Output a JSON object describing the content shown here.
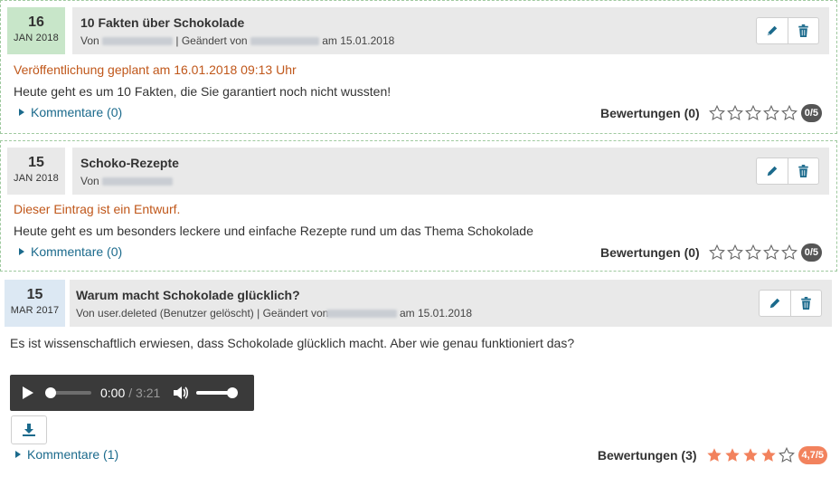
{
  "entries": [
    {
      "date_day": "16",
      "date_month": "JAN 2018",
      "title": "10 Fakten über Schokolade",
      "by_prefix": "Von",
      "changed_prefix": "| Geändert von",
      "changed_date": "am 15.01.2018",
      "notice": "Veröffentlichung geplant am 16.01.2018 09:13 Uhr",
      "text": "Heute geht es um 10 Fakten, die Sie garantiert noch nicht wussten!",
      "comments": "Kommentare (0)",
      "rating_label": "Bewertungen (0)",
      "rating_score": "0/5",
      "rating_value": 0
    },
    {
      "date_day": "15",
      "date_month": "JAN 2018",
      "title": "Schoko-Rezepte",
      "by_prefix": "Von",
      "notice": "Dieser Eintrag ist ein Entwurf.",
      "text": "Heute geht es um besonders leckere und einfache Rezepte rund um das Thema Schokolade",
      "comments": "Kommentare (0)",
      "rating_label": "Bewertungen (0)",
      "rating_score": "0/5",
      "rating_value": 0
    },
    {
      "date_day": "15",
      "date_month": "MAR 2017",
      "title": "Warum macht Schokolade glücklich?",
      "byline": "Von user.deleted (Benutzer gelöscht) | Geändert von",
      "changed_date": "am 15.01.2018",
      "text": "Es ist wissenschaftlich erwiesen, dass Schokolade glücklich macht. Aber wie genau funktioniert das?",
      "audio_current": "0:00",
      "audio_total": "/ 3:21",
      "audio_progress": 0,
      "audio_volume": 1.0,
      "comments": "Kommentare (1)",
      "rating_label": "Bewertungen (3)",
      "rating_score": "4,7/5",
      "rating_value": 4.7
    }
  ],
  "colors": {
    "date_scheduled": "#c8e6c9",
    "date_draft": "#e9e9e9",
    "date_published": "#dce8f3",
    "accent": "#1b6a8c",
    "notice": "#c0571a",
    "star_filled": "#f2825d"
  }
}
